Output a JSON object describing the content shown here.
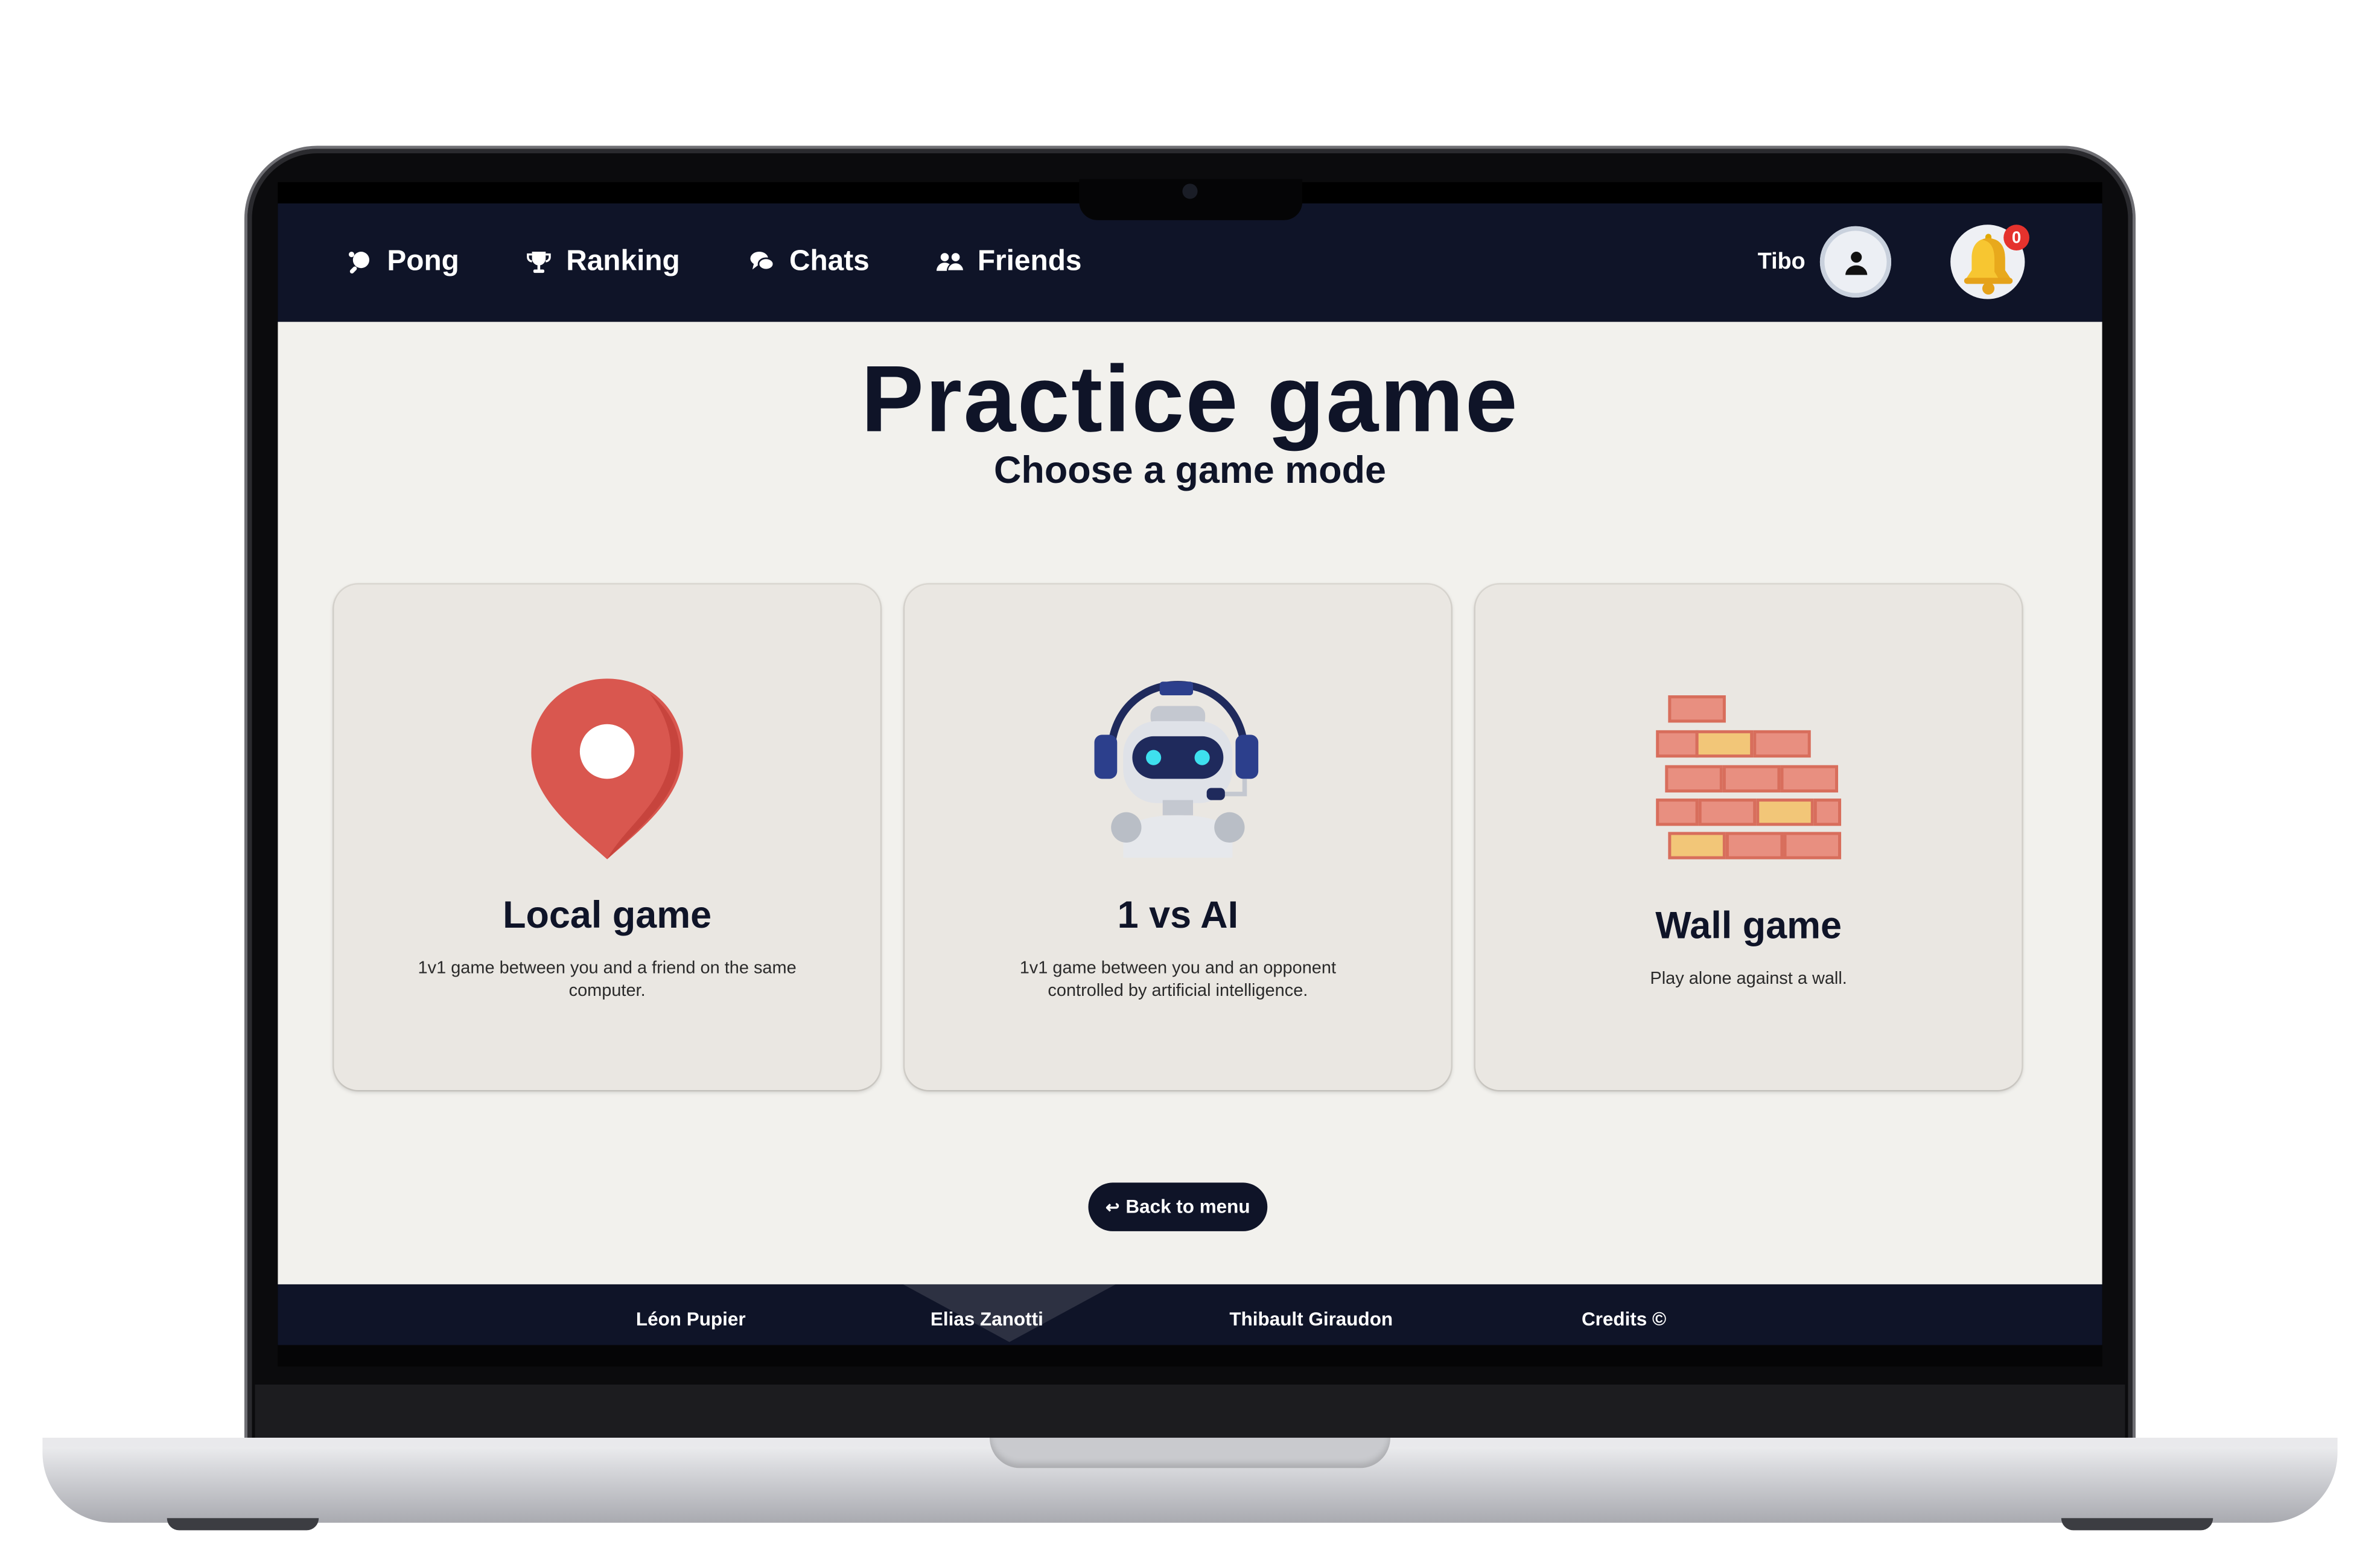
{
  "nav": {
    "items": [
      {
        "label": "Pong",
        "icon": "ping-pong-icon"
      },
      {
        "label": "Ranking",
        "icon": "trophy-icon"
      },
      {
        "label": "Chats",
        "icon": "chat-bubbles-icon"
      },
      {
        "label": "Friends",
        "icon": "people-icon"
      }
    ],
    "user_name": "Tibo",
    "notifications_count": "0"
  },
  "main": {
    "title": "Practice game",
    "subtitle": "Choose a game mode",
    "cards": [
      {
        "title": "Local game",
        "description": "1v1 game between you and a friend on the same computer.",
        "icon": "map-pin-icon"
      },
      {
        "title": "1 vs AI",
        "description": "1v1 game between you and an opponent controlled by artificial intelligence.",
        "icon": "robot-icon"
      },
      {
        "title": "Wall game",
        "description": "Play alone against a wall.",
        "icon": "brick-wall-icon"
      }
    ],
    "back_button": "Back to menu"
  },
  "footer": {
    "credits": [
      "Léon Pupier",
      "Elias Zanotti",
      "Thibault Giraudon",
      "Credits ©"
    ]
  },
  "colors": {
    "navy": "#0f1428",
    "background": "#f2f1ed",
    "card": "#eae7e2",
    "badge": "#e5322d"
  }
}
